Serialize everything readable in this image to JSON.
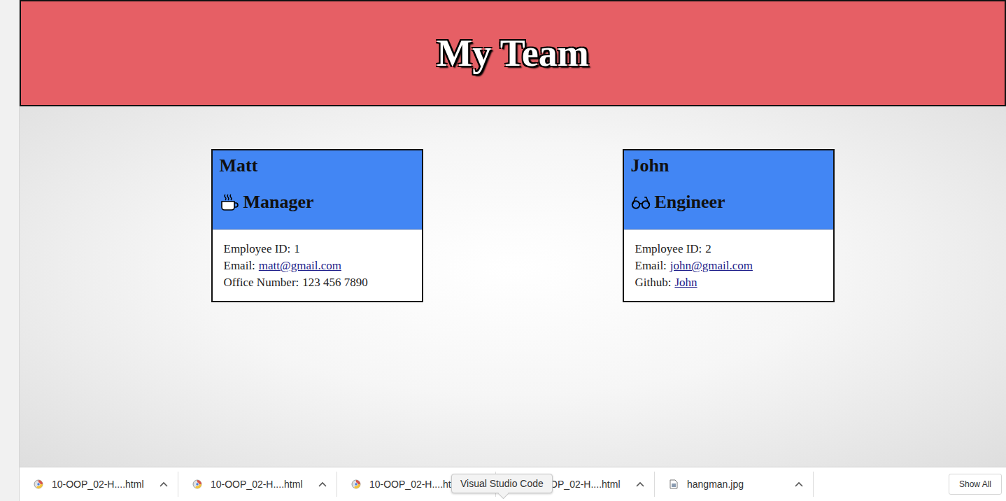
{
  "header": {
    "title": "My Team"
  },
  "employees": [
    {
      "name": "Matt",
      "role": "Manager",
      "kind": "manager",
      "fields": [
        {
          "label": "Employee ID:",
          "value": "1",
          "link": false
        },
        {
          "label": "Email:",
          "value": "matt@gmail.com",
          "link": true
        },
        {
          "label": "Office Number:",
          "value": "123 456 7890",
          "link": false
        }
      ]
    },
    {
      "name": "John",
      "role": "Engineer",
      "kind": "engineer",
      "fields": [
        {
          "label": "Employee ID:",
          "value": "2",
          "link": false
        },
        {
          "label": "Email:",
          "value": "john@gmail.com",
          "link": true
        },
        {
          "label": "Github:",
          "value": "John",
          "link": true
        }
      ]
    }
  ],
  "downloads": {
    "items": [
      {
        "name": "10-OOP_02-H....html",
        "kind": "html"
      },
      {
        "name": "10-OOP_02-H....html",
        "kind": "html"
      },
      {
        "name": "10-OOP_02-H....html",
        "kind": "html"
      },
      {
        "name": "10-OOP_02-H....html",
        "kind": "html"
      },
      {
        "name": "hangman.jpg",
        "kind": "image"
      }
    ],
    "show_all": "Show All"
  },
  "tooltip": "Visual Studio Code"
}
